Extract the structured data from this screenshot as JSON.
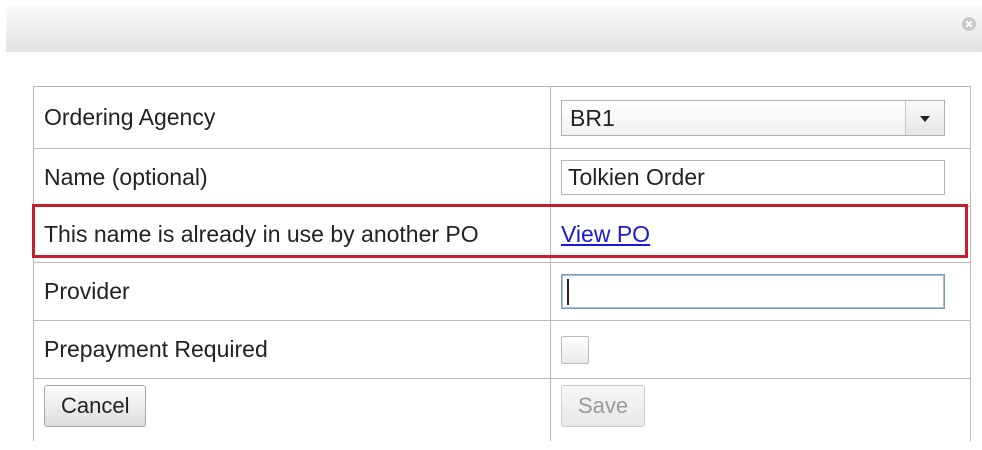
{
  "dialog": {
    "close_icon": "close-circle-icon"
  },
  "form": {
    "ordering_agency": {
      "label": "Ordering Agency",
      "selected": "BR1"
    },
    "name": {
      "label": "Name (optional)",
      "value": "Tolkien Order"
    },
    "notice": {
      "message": "This name is already in use by another PO",
      "link": "View PO",
      "highlight_color": "#c4202c"
    },
    "provider": {
      "label": "Provider",
      "value": ""
    },
    "prepayment": {
      "label": "Prepayment Required",
      "checked": false
    },
    "buttons": {
      "cancel": "Cancel",
      "save": "Save"
    }
  },
  "colors": {
    "link": "#1a1ad6",
    "border": "#b9b9b9"
  }
}
